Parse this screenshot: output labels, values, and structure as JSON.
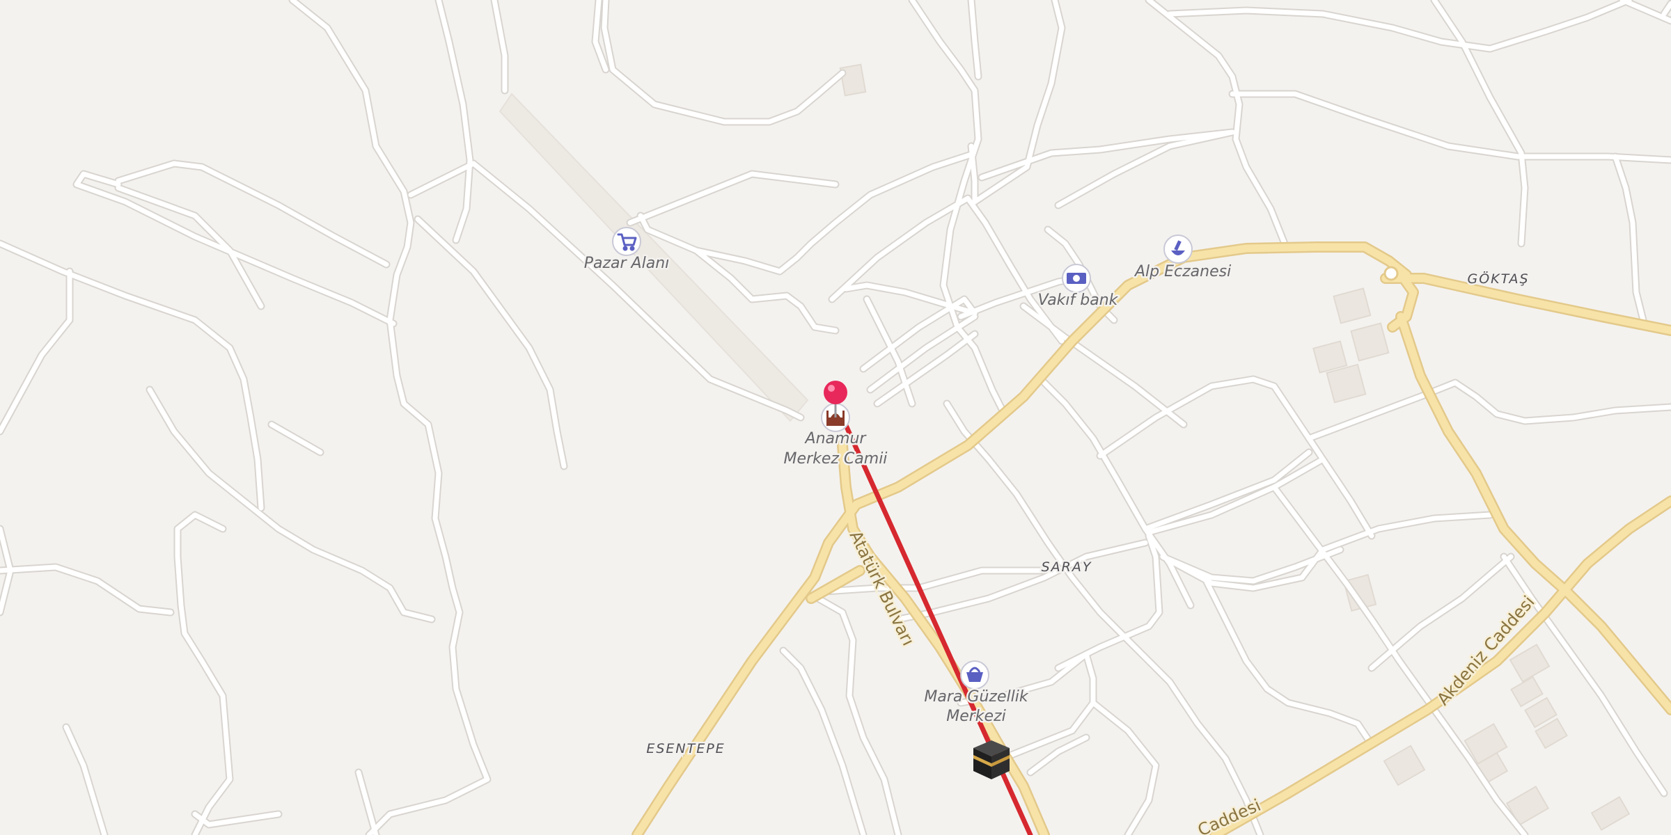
{
  "map": {
    "colors": {
      "background": "#f4f2ef",
      "minor_road": "#ffffff",
      "main_road": "#f7e3a8",
      "route_line": "#d6282f",
      "pin": "#e8285a",
      "poi_icon": "#5a5fc2"
    },
    "pois": [
      {
        "icon": "shopping-cart-icon",
        "label": "Pazar Alanı"
      },
      {
        "icon": "mosque-icon",
        "label_line1": "Anamur",
        "label_line2": "Merkez Camii"
      },
      {
        "icon": "banknote-icon",
        "label": "Vakıf bank"
      },
      {
        "icon": "pharmacy-icon",
        "label": "Alp Eczanesi"
      },
      {
        "icon": "shopping-basket-icon",
        "label_line1": "Mara Güzellik",
        "label_line2": "Merkezi"
      }
    ],
    "areas": [
      "GÖKTAŞ",
      "SARAY",
      "ESENTEPE"
    ],
    "streets": [
      "Atatürk Bulvarı",
      "Akdeniz Caddesi",
      "Caddesi"
    ],
    "markers": {
      "pin": "location-pin-icon",
      "destination": "kaaba-icon"
    }
  }
}
